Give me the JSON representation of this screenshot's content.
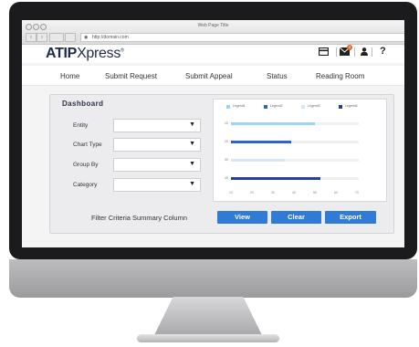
{
  "browser": {
    "page_title": "Web Page Title",
    "url": "http://domain.com",
    "back": "‹",
    "forward": "›"
  },
  "app": {
    "logo_bold": "ATIP",
    "logo_light": "Xpress",
    "logo_mark": "®",
    "notification_count": "3"
  },
  "nav": {
    "items": [
      "Home",
      "Submit Request",
      "Submit Appeal",
      "Status",
      "Reading Room"
    ]
  },
  "dashboard": {
    "title": "Dashboard",
    "filters": [
      {
        "label": "Entity",
        "value": ""
      },
      {
        "label": "Chart Type",
        "value": ""
      },
      {
        "label": "Group By",
        "value": ""
      },
      {
        "label": "Category",
        "value": ""
      }
    ],
    "summary_label": "Filter Criteria Summary Column",
    "buttons": {
      "view": "View",
      "clear": "Clear",
      "export": "Export"
    }
  },
  "colors": {
    "accent": "#2f7bd6",
    "series1": "#9fd3f4",
    "series2": "#2e63c7",
    "series3": "#d6e6f5",
    "series4": "#2a3f9c"
  },
  "chart_data": {
    "type": "bar",
    "orientation": "horizontal",
    "legend_position": "top",
    "series": [
      {
        "name": "Legend1",
        "color": "#9fd3f4"
      },
      {
        "name": "Legend2",
        "color": "#2e63c7"
      },
      {
        "name": "Legend3",
        "color": "#d6e6f5"
      },
      {
        "name": "Legend4",
        "color": "#2a3f9c"
      }
    ],
    "categories": [
      "10",
      "20",
      "30",
      "40"
    ],
    "values": [
      0.66,
      0.47,
      0.42,
      0.7
    ],
    "xticks": [
      "10",
      "20",
      "30",
      "40",
      "50",
      "60",
      "70"
    ]
  }
}
